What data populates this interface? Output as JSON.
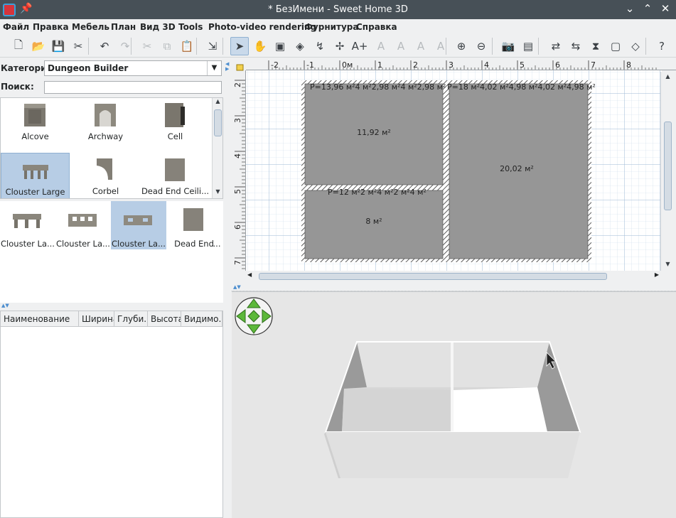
{
  "window": {
    "title": "* БезИмени - Sweet Home 3D",
    "icons": [
      "app-icon",
      "pin-icon",
      "minimize-icon",
      "maximize-icon",
      "close-icon"
    ]
  },
  "menu": [
    "Файл",
    "Правка",
    "Мебель",
    "План",
    "Вид 3D",
    "Tools",
    "Photo-video rendering",
    "Фурнитура",
    "Справка"
  ],
  "toolbar": {
    "buttons": [
      {
        "name": "new-home",
        "glyph": "🗋",
        "enabled": true
      },
      {
        "name": "open",
        "glyph": "📂",
        "enabled": true
      },
      {
        "name": "save",
        "glyph": "💾",
        "enabled": true
      },
      {
        "name": "preferences",
        "glyph": "✂",
        "enabled": true
      },
      {
        "name": "undo",
        "glyph": "↶",
        "enabled": true
      },
      {
        "name": "redo",
        "glyph": "↷",
        "enabled": false
      },
      {
        "name": "cut",
        "glyph": "✂",
        "enabled": false
      },
      {
        "name": "copy",
        "glyph": "⧉",
        "enabled": false
      },
      {
        "name": "paste",
        "glyph": "📋",
        "enabled": false
      },
      {
        "name": "add-furniture",
        "glyph": "⇲",
        "enabled": true
      },
      {
        "name": "select-mode",
        "glyph": "➤",
        "enabled": true,
        "active": true
      },
      {
        "name": "pan-mode",
        "glyph": "✋",
        "enabled": true
      },
      {
        "name": "create-walls",
        "glyph": "▣",
        "enabled": true
      },
      {
        "name": "create-rooms",
        "glyph": "◈",
        "enabled": true
      },
      {
        "name": "create-polylines",
        "glyph": "↯",
        "enabled": true
      },
      {
        "name": "create-dimensions",
        "glyph": "✢",
        "enabled": true
      },
      {
        "name": "add-text",
        "glyph": "A+",
        "enabled": true
      },
      {
        "name": "text-style-1",
        "glyph": "A",
        "enabled": false
      },
      {
        "name": "text-style-2",
        "glyph": "A",
        "enabled": false
      },
      {
        "name": "text-bold",
        "glyph": "A",
        "enabled": false
      },
      {
        "name": "text-italic",
        "glyph": "A",
        "enabled": false
      },
      {
        "name": "zoom-in",
        "glyph": "⊕",
        "enabled": true
      },
      {
        "name": "zoom-out",
        "glyph": "⊖",
        "enabled": true
      },
      {
        "name": "create-photo",
        "glyph": "📷",
        "enabled": true
      },
      {
        "name": "create-video",
        "glyph": "▤",
        "enabled": true
      },
      {
        "name": "tool-1",
        "glyph": "⇄",
        "enabled": true
      },
      {
        "name": "tool-2",
        "glyph": "⇆",
        "enabled": true
      },
      {
        "name": "flip",
        "glyph": "⧗",
        "enabled": true
      },
      {
        "name": "tool-4",
        "glyph": "▢",
        "enabled": true
      },
      {
        "name": "tool-5",
        "glyph": "◇",
        "enabled": true
      },
      {
        "name": "help",
        "glyph": "?",
        "enabled": true
      }
    ]
  },
  "catalog": {
    "category_label": "Категория",
    "category_value": "Dungeon Builder",
    "search_label": "Поиск:",
    "search_value": "",
    "items": [
      {
        "name": "Alcove",
        "selected": false
      },
      {
        "name": "Archway",
        "selected": false
      },
      {
        "name": "Cell",
        "selected": false
      },
      {
        "name": "Clouster Large",
        "selected": true
      },
      {
        "name": "Corbel",
        "selected": false
      },
      {
        "name": "Dead End   Ceili...",
        "selected": false
      }
    ]
  },
  "furniture_list": {
    "items": [
      {
        "name": "Clouster La...",
        "selected": false
      },
      {
        "name": "Clouster La...",
        "selected": false
      },
      {
        "name": "Clouster La...",
        "selected": true
      },
      {
        "name": "Dead End",
        "selected": false
      },
      {
        "name": "...",
        "selected": false
      }
    ]
  },
  "table": {
    "columns": [
      "Наименование",
      "Ширина",
      "Глуби...",
      "Высота",
      "Видимо..."
    ]
  },
  "plan": {
    "ruler_x": [
      "-2",
      "-1",
      "0м",
      "1",
      "2",
      "3",
      "4",
      "5",
      "6",
      "7",
      "8"
    ],
    "ruler_y": [
      "2",
      "3",
      "4",
      "5",
      "6",
      "7"
    ],
    "rooms": [
      {
        "perimeter": "P=13,96 м²4 м²2,98 м²4 м²2,98 м²",
        "area": "11,92 м²"
      },
      {
        "perimeter": "P=18 м²4,02 м²4,98 м²4,02 м²4,98 м²",
        "area": "20,02 м²"
      },
      {
        "perimeter": "P=12 м²2 м²4 м²2 м²4 м²",
        "area": "8 м²"
      }
    ]
  },
  "view3d": {
    "icons": [
      "navigation-arrows-icon",
      "mouse-pointer-icon"
    ]
  }
}
